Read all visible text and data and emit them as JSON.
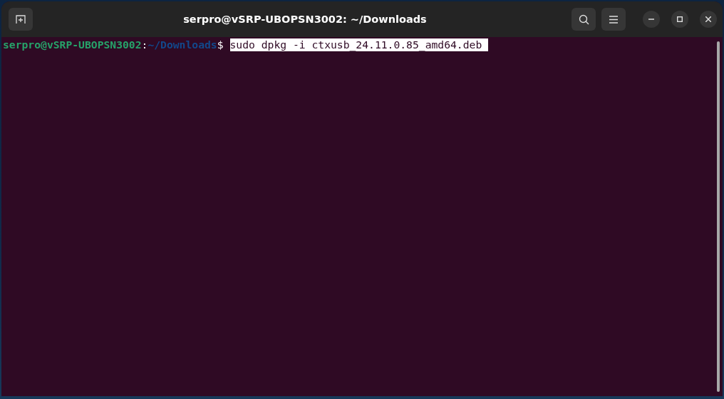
{
  "window": {
    "title": "serpro@vSRP-UBOPSN3002: ~/Downloads"
  },
  "terminal": {
    "lines": [
      {
        "user_host": "serpro@vSRP-UBOPSN3002",
        "separator": ":",
        "path": "~/Downloads",
        "prompt_symbol": "$",
        "command": "sudo dpkg -i ctxusb_24.11.0.85_amd64.deb ",
        "selected": true
      }
    ]
  }
}
